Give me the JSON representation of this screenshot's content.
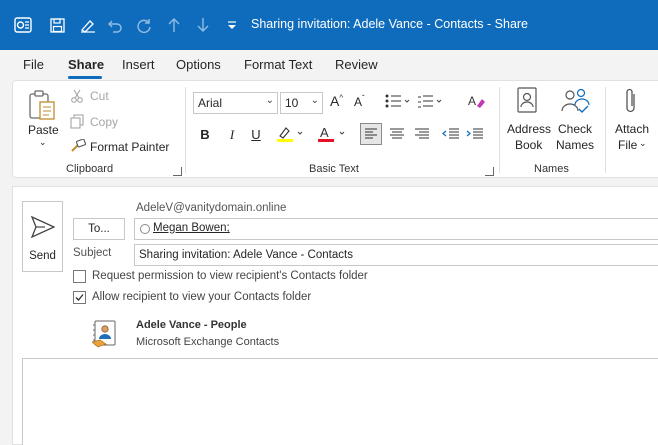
{
  "window": {
    "title": "Sharing invitation: Adele Vance - Contacts  -  Share",
    "brand_color": "#0f6cbd"
  },
  "quick_access": [
    "outlook-icon",
    "save-icon",
    "signature-icon",
    "undo-icon",
    "redo-icon",
    "up-icon",
    "down-icon",
    "customize-icon"
  ],
  "tabs": [
    "File",
    "Share",
    "Insert",
    "Options",
    "Format Text",
    "Review"
  ],
  "active_tab": "Share",
  "ribbon": {
    "clipboard": {
      "paste": "Paste",
      "cut": "Cut",
      "copy": "Copy",
      "format_painter": "Format Painter",
      "label": "Clipboard"
    },
    "basic_text": {
      "font": "Arial",
      "size": "10",
      "bold": "B",
      "italic": "I",
      "underline": "U",
      "label": "Basic Text",
      "highlight_color": "#ffff00",
      "font_color": "#e81123"
    },
    "names": {
      "address_book_line1": "Address",
      "address_book_line2": "Book",
      "check_names_line1": "Check",
      "check_names_line2": "Names",
      "label": "Names"
    },
    "attach": {
      "line1": "Attach",
      "line2": "File"
    }
  },
  "message": {
    "send": "Send",
    "from": "AdeleV@vanitydomain.online",
    "to_button": "To...",
    "to_recipient": "Megan Bowen;",
    "subject_label": "Subject",
    "subject": "Sharing invitation: Adele Vance - Contacts",
    "request_permission": "Request permission to view recipient's Contacts folder",
    "request_permission_checked": false,
    "allow_view": "Allow recipient to view your Contacts folder",
    "allow_view_checked": true,
    "attachment_title": "Adele Vance - People",
    "attachment_subtitle": "Microsoft Exchange Contacts"
  }
}
